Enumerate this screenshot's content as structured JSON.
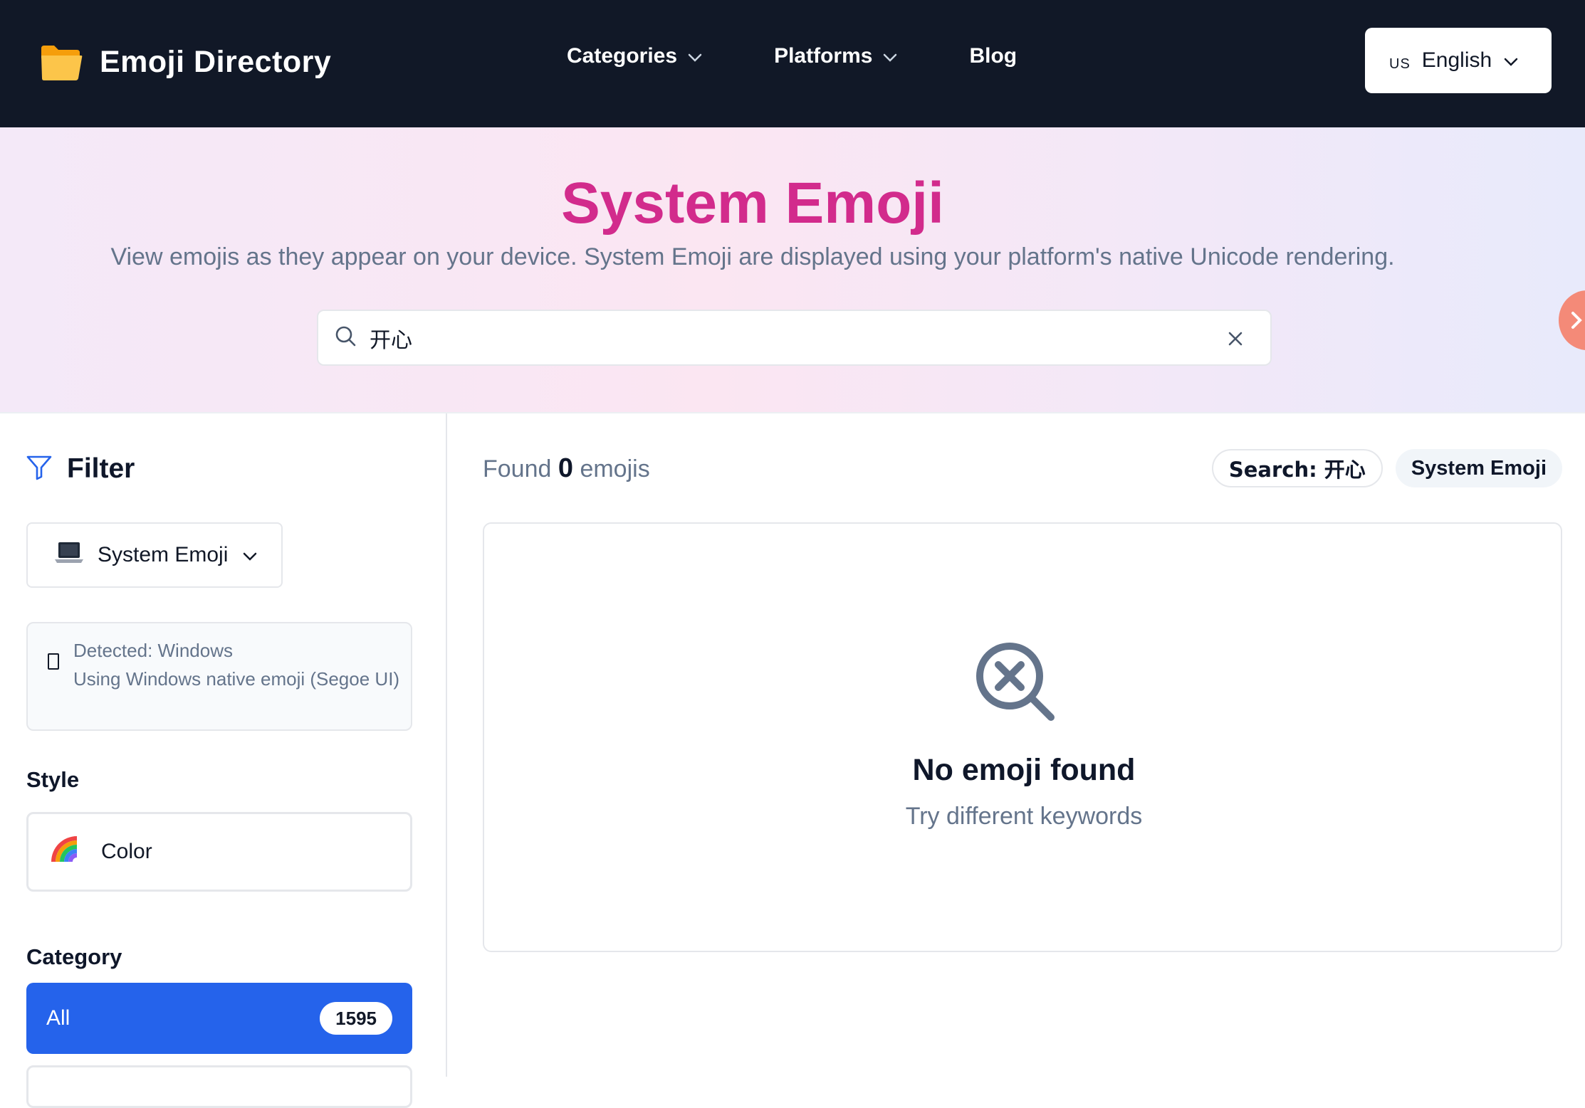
{
  "navbar": {
    "brand_title": "Emoji Directory",
    "brand_icon": "folder-icon",
    "links": [
      {
        "label": "Categories",
        "has_dropdown": true
      },
      {
        "label": "Platforms",
        "has_dropdown": true
      },
      {
        "label": "Blog",
        "has_dropdown": false
      }
    ],
    "language": {
      "flag": "US",
      "label": "English"
    }
  },
  "hero": {
    "title": "System Emoji",
    "subtitle": "View emojis as they appear on your device. System Emoji are displayed using your platform's native Unicode rendering.",
    "search": {
      "value": "开心",
      "placeholder": ""
    }
  },
  "sidebar": {
    "filter_title": "Filter",
    "platform_select": {
      "icon": "laptop-emoji",
      "value": "System Emoji"
    },
    "detected": {
      "line1": "Detected: Windows",
      "line2": "Using Windows native emoji (Segoe UI)"
    },
    "style_label": "Style",
    "style_option": {
      "icon": "rainbow-emoji",
      "label": "Color"
    },
    "category_label": "Category",
    "categories": [
      {
        "label": "All",
        "count": "1595",
        "selected": true
      }
    ]
  },
  "main": {
    "found_prefix": "Found",
    "found_count": "0",
    "found_suffix": "emojis",
    "chips": [
      {
        "label": "Search: 开心"
      },
      {
        "label": "System Emoji"
      }
    ],
    "empty": {
      "title": "No emoji found",
      "subtitle": "Try different keywords"
    }
  },
  "colors": {
    "navbar_bg": "#111827",
    "accent_pink": "#d22b8c",
    "primary_blue": "#2563eb",
    "muted_text": "#64748b",
    "folder_yellow": "#fbbf24"
  }
}
